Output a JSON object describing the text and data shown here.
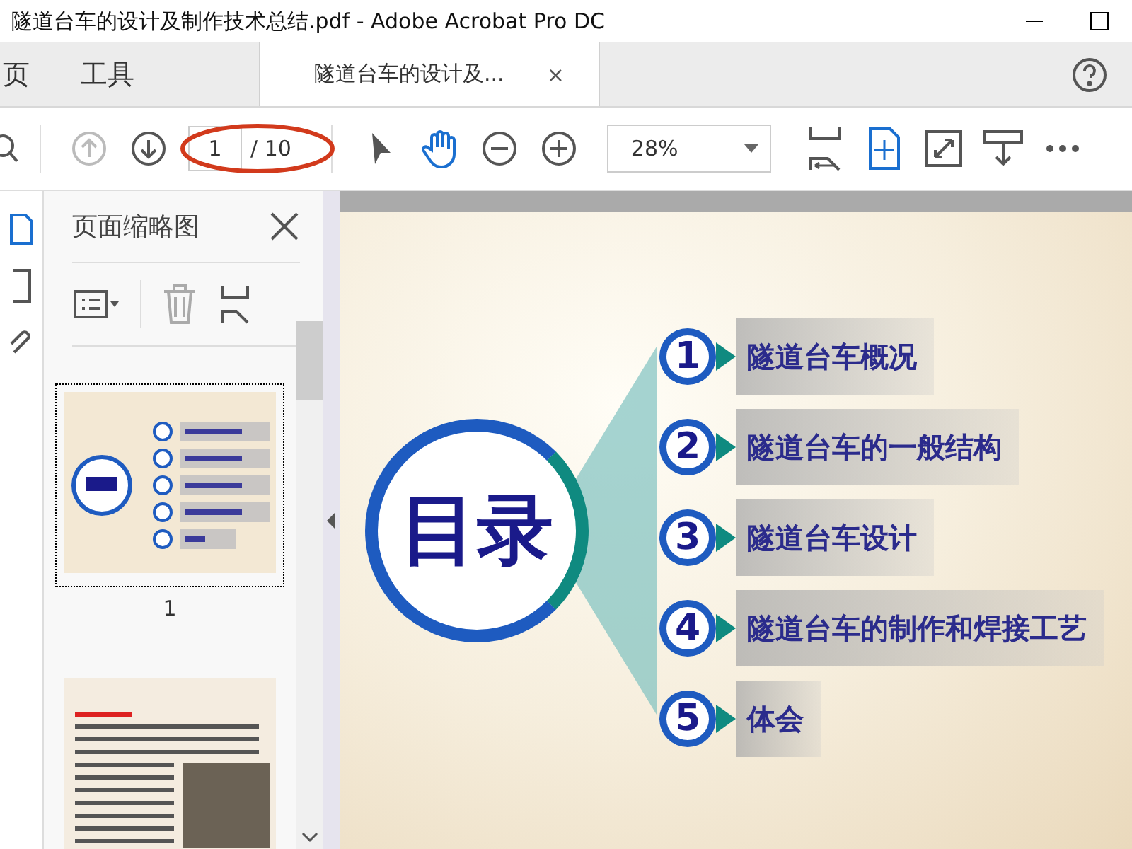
{
  "window": {
    "title": "隧道台车的设计及制作技术总结.pdf - Adobe Acrobat Pro DC"
  },
  "tabs": [
    {
      "label": "页",
      "selected": false
    },
    {
      "label": "工具",
      "selected": false
    },
    {
      "label": "隧道台车的设计及...",
      "selected": true,
      "close": "×"
    }
  ],
  "toolbar": {
    "page": "1",
    "page_total": "/ 10",
    "zoom": "28%"
  },
  "thumbnail_panel": {
    "title": "页面缩略图",
    "pages": [
      {
        "label": "1",
        "selected": true
      },
      {
        "selected": false
      }
    ]
  },
  "slide": {
    "title": "目录",
    "items": [
      {
        "number": "1",
        "text": "隧道台车概况"
      },
      {
        "number": "2",
        "text": "隧道台车的一般结构"
      },
      {
        "number": "3",
        "text": "隧道台车设计"
      },
      {
        "number": "4",
        "text": "隧道台车的制作和焊接工艺"
      },
      {
        "number": "5",
        "text": "体会"
      }
    ]
  }
}
